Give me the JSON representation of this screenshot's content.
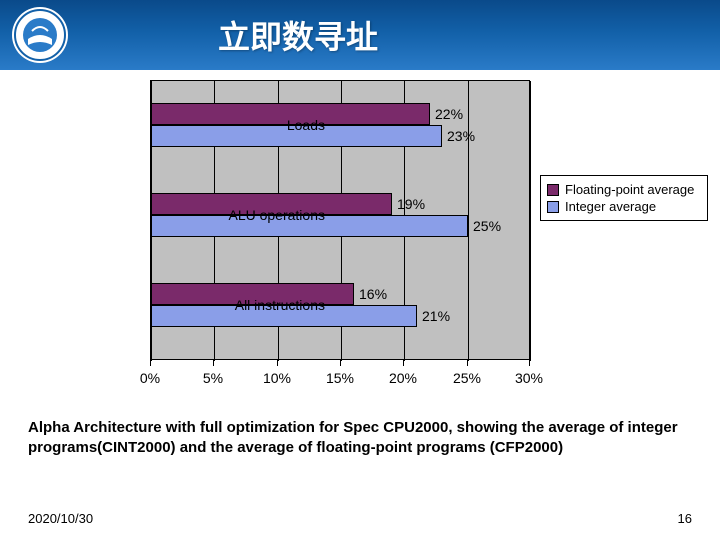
{
  "header": {
    "title": "立即数寻址"
  },
  "chart_data": {
    "type": "bar",
    "orientation": "horizontal",
    "categories": [
      "Loads",
      "ALU operations",
      "All instructions"
    ],
    "series": [
      {
        "name": "Floating-point average",
        "values": [
          22,
          19,
          16
        ],
        "color": "#7a2a6a"
      },
      {
        "name": "Integer average",
        "values": [
          23,
          25,
          21
        ],
        "color": "#8a9ee8"
      }
    ],
    "xlabel": "",
    "ylabel": "",
    "xlim": [
      0,
      30
    ],
    "xticks": [
      0,
      5,
      10,
      15,
      20,
      25,
      30
    ],
    "xtick_labels": [
      "0%",
      "5%",
      "10%",
      "15%",
      "20%",
      "25%",
      "30%"
    ],
    "value_labels": [
      [
        "22%",
        "23%"
      ],
      [
        "19%",
        "25%"
      ],
      [
        "16%",
        "21%"
      ]
    ],
    "grid": true,
    "legend_position": "right"
  },
  "legend": {
    "items": [
      "Floating-point average",
      "Integer average"
    ]
  },
  "caption": "Alpha Architecture with full optimization for Spec CPU2000, showing the average of integer programs(CINT2000) and the average of floating-point programs (CFP2000)",
  "footer": {
    "date": "2020/10/30",
    "page": "16"
  }
}
